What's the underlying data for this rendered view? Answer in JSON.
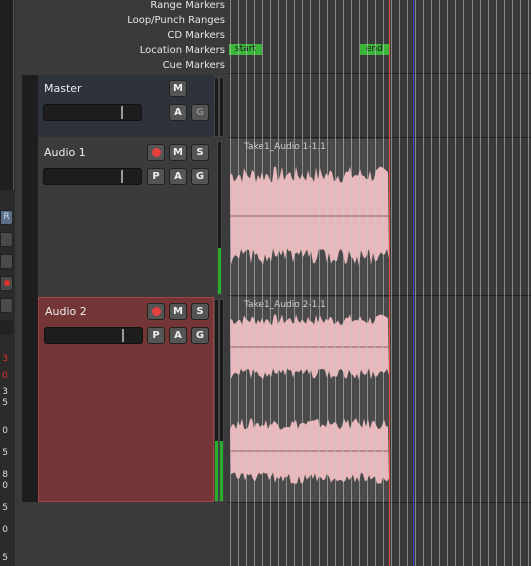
{
  "ruler": {
    "range_markers": "Range Markers",
    "loop_punch_ranges": "Loop/Punch Ranges",
    "cd_markers": "CD Markers",
    "location_markers": "Location Markers",
    "cue_markers": "Cue Markers"
  },
  "markers": {
    "start": "start",
    "end": "end"
  },
  "tracks": {
    "master": {
      "name": "Master",
      "btn_m": "M",
      "btn_a": "A",
      "btn_g": "G"
    },
    "audio1": {
      "name": "Audio 1",
      "btn_m": "M",
      "btn_s": "S",
      "btn_p": "P",
      "btn_a": "A",
      "btn_g": "G",
      "region": "Take1_Audio 1-1.1",
      "meter_level": 0.3
    },
    "audio2": {
      "name": "Audio 2",
      "btn_m": "M",
      "btn_s": "S",
      "btn_p": "P",
      "btn_a": "A",
      "btn_g": "G",
      "region": "Take1_Audio 2-1.1",
      "meter_level": 0.3
    }
  },
  "left_strip": {
    "btn_r": "R",
    "nums": [
      "3",
      "0",
      "3",
      "5",
      "0",
      "5",
      "8",
      "0",
      "5",
      "0",
      "5"
    ]
  },
  "colors": {
    "selected_track": "#7a3535",
    "playhead": "#e84848",
    "edit_point": "#3a40c8",
    "waveform": "#e8b8bc",
    "marker": "#3ab53a"
  }
}
